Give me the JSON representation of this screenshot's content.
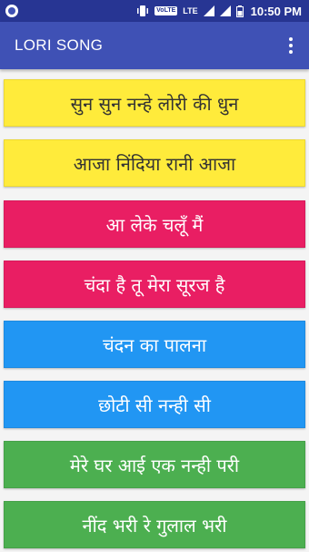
{
  "status_bar": {
    "volte": "VoLTE",
    "lte": "LTE",
    "time": "10:50 PM"
  },
  "app_bar": {
    "title": "LORI SONG",
    "menu_icon": "more-vert-icon"
  },
  "songs": [
    {
      "label": "सुन सुन नन्हे लोरी की धुन",
      "bg": "#ffeb3b",
      "fg": "#333333"
    },
    {
      "label": "आजा निंदिया रानी आजा",
      "bg": "#ffeb3b",
      "fg": "#333333"
    },
    {
      "label": "आ लेके चलूँ मैं",
      "bg": "#e91e63",
      "fg": "#ffffff"
    },
    {
      "label": "चंदा है तू मेरा सूरज है",
      "bg": "#e91e63",
      "fg": "#ffffff"
    },
    {
      "label": "चंदन का पालना",
      "bg": "#2196f3",
      "fg": "#ffffff"
    },
    {
      "label": "छोटी सी नन्ही सी",
      "bg": "#2196f3",
      "fg": "#ffffff"
    },
    {
      "label": "मेरे घर आई एक नन्ही परी",
      "bg": "#4caf50",
      "fg": "#ffffff"
    },
    {
      "label": "नींद भरी रे गुलाल भरी",
      "bg": "#4caf50",
      "fg": "#ffffff"
    }
  ]
}
